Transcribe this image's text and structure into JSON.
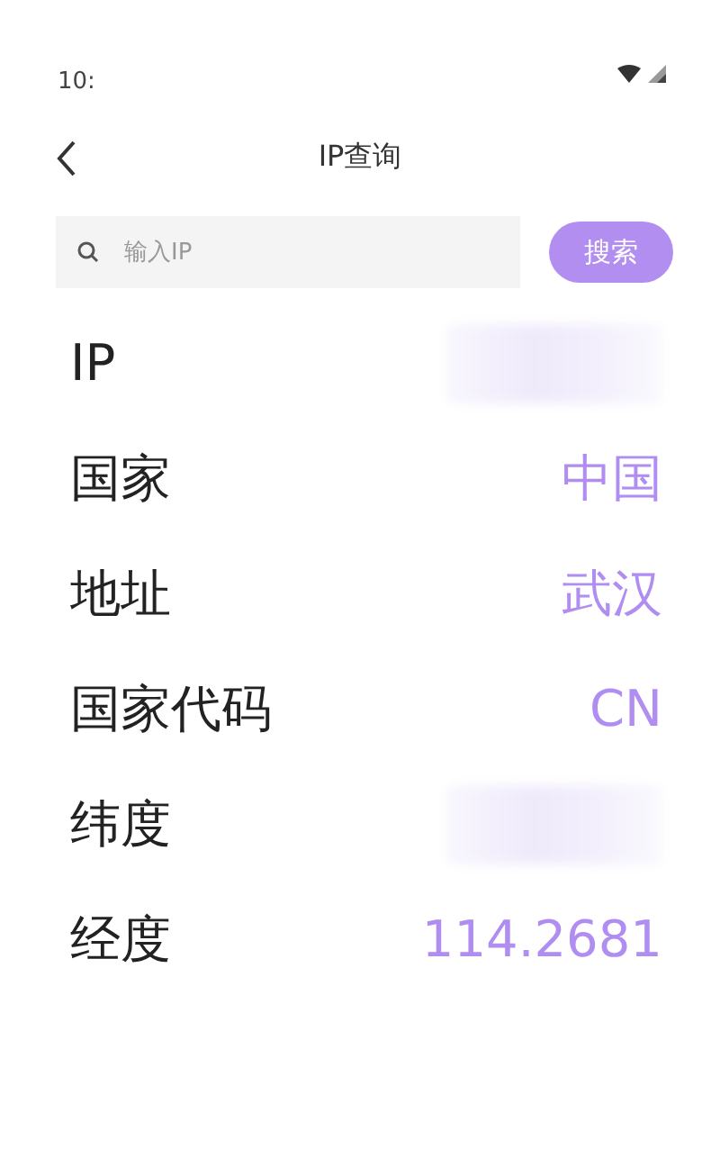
{
  "status_bar": {
    "time": "10:"
  },
  "header": {
    "title": "IP查询"
  },
  "search": {
    "placeholder": "输入IP",
    "button": "搜索"
  },
  "rows": [
    {
      "label": "IP",
      "kind": "redacted"
    },
    {
      "label": "国家",
      "kind": "text",
      "value": "中国"
    },
    {
      "label": "地址",
      "kind": "text",
      "value": "武汉"
    },
    {
      "label": "国家代码",
      "kind": "text",
      "value": "CN"
    },
    {
      "label": "纬度",
      "kind": "redacted"
    },
    {
      "label": "经度",
      "kind": "text",
      "value": "114.2681"
    }
  ]
}
